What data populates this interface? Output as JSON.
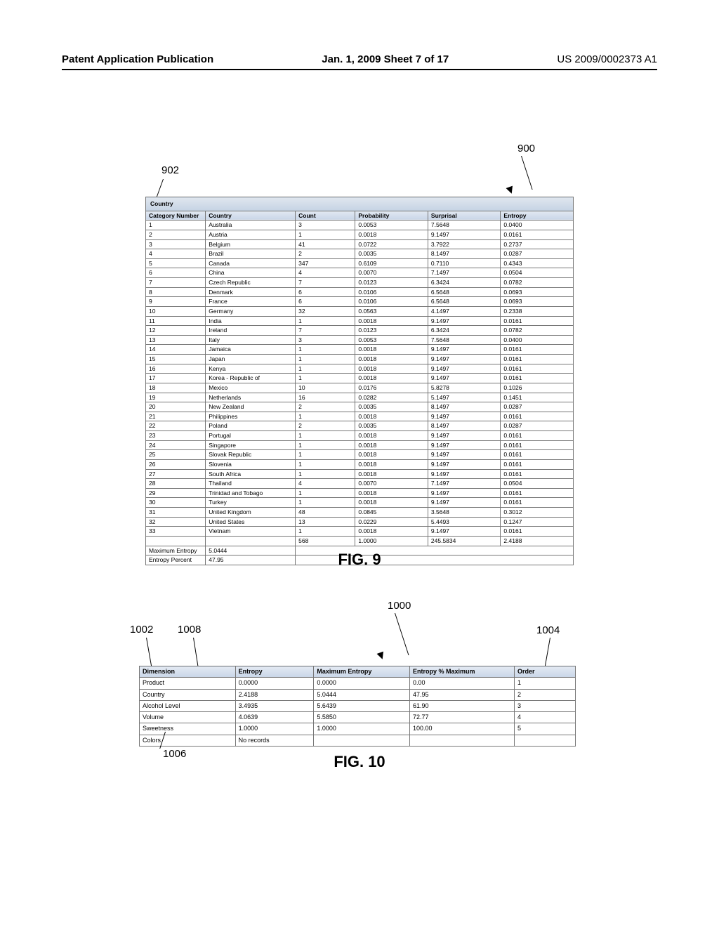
{
  "header": {
    "left": "Patent Application Publication",
    "center": "Jan. 1, 2009  Sheet 7 of 17",
    "right": "US 2009/0002373 A1"
  },
  "callouts": {
    "c900": "900",
    "c902": "902",
    "c1000": "1000",
    "c1002": "1002",
    "c1004": "1004",
    "c1006": "1006",
    "c1008": "1008"
  },
  "fig9": {
    "title": "Country",
    "headers": [
      "Category Number",
      "Country",
      "Count",
      "Probability",
      "Surprisal",
      "Entropy"
    ],
    "rows": [
      [
        "1",
        "Australia",
        "3",
        "0.0053",
        "7.5648",
        "0.0400"
      ],
      [
        "2",
        "Austria",
        "1",
        "0.0018",
        "9.1497",
        "0.0161"
      ],
      [
        "3",
        "Belgium",
        "41",
        "0.0722",
        "3.7922",
        "0.2737"
      ],
      [
        "4",
        "Brazil",
        "2",
        "0.0035",
        "8.1497",
        "0.0287"
      ],
      [
        "5",
        "Canada",
        "347",
        "0.6109",
        "0.7110",
        "0.4343"
      ],
      [
        "6",
        "China",
        "4",
        "0.0070",
        "7.1497",
        "0.0504"
      ],
      [
        "7",
        "Czech Republic",
        "7",
        "0.0123",
        "6.3424",
        "0.0782"
      ],
      [
        "8",
        "Denmark",
        "6",
        "0.0106",
        "6.5648",
        "0.0693"
      ],
      [
        "9",
        "France",
        "6",
        "0.0106",
        "6.5648",
        "0.0693"
      ],
      [
        "10",
        "Germany",
        "32",
        "0.0563",
        "4.1497",
        "0.2338"
      ],
      [
        "11",
        "India",
        "1",
        "0.0018",
        "9.1497",
        "0.0161"
      ],
      [
        "12",
        "Ireland",
        "7",
        "0.0123",
        "6.3424",
        "0.0782"
      ],
      [
        "13",
        "Italy",
        "3",
        "0.0053",
        "7.5648",
        "0.0400"
      ],
      [
        "14",
        "Jamaica",
        "1",
        "0.0018",
        "9.1497",
        "0.0161"
      ],
      [
        "15",
        "Japan",
        "1",
        "0.0018",
        "9.1497",
        "0.0161"
      ],
      [
        "16",
        "Kenya",
        "1",
        "0.0018",
        "9.1497",
        "0.0161"
      ],
      [
        "17",
        "Korea - Republic of",
        "1",
        "0.0018",
        "9.1497",
        "0.0161"
      ],
      [
        "18",
        "Mexico",
        "10",
        "0.0176",
        "5.8278",
        "0.1026"
      ],
      [
        "19",
        "Netherlands",
        "16",
        "0.0282",
        "5.1497",
        "0.1451"
      ],
      [
        "20",
        "New Zealand",
        "2",
        "0.0035",
        "8.1497",
        "0.0287"
      ],
      [
        "21",
        "Philippines",
        "1",
        "0.0018",
        "9.1497",
        "0.0161"
      ],
      [
        "22",
        "Poland",
        "2",
        "0.0035",
        "8.1497",
        "0.0287"
      ],
      [
        "23",
        "Portugal",
        "1",
        "0.0018",
        "9.1497",
        "0.0161"
      ],
      [
        "24",
        "Singapore",
        "1",
        "0.0018",
        "9.1497",
        "0.0161"
      ],
      [
        "25",
        "Slovak Republic",
        "1",
        "0.0018",
        "9.1497",
        "0.0161"
      ],
      [
        "26",
        "Slovenia",
        "1",
        "0.0018",
        "9.1497",
        "0.0161"
      ],
      [
        "27",
        "South Africa",
        "1",
        "0.0018",
        "9.1497",
        "0.0161"
      ],
      [
        "28",
        "Thailand",
        "4",
        "0.0070",
        "7.1497",
        "0.0504"
      ],
      [
        "29",
        "Trinidad and Tobago",
        "1",
        "0.0018",
        "9.1497",
        "0.0161"
      ],
      [
        "30",
        "Turkey",
        "1",
        "0.0018",
        "9.1497",
        "0.0161"
      ],
      [
        "31",
        "United Kingdom",
        "48",
        "0.0845",
        "3.5648",
        "0.3012"
      ],
      [
        "32",
        "United States",
        "13",
        "0.0229",
        "5.4493",
        "0.1247"
      ],
      [
        "33",
        "Vietnam",
        "1",
        "0.0018",
        "9.1497",
        "0.0161"
      ]
    ],
    "total_row": [
      "",
      "",
      "568",
      "1.0000",
      "245.5834",
      "2.4188"
    ],
    "max_entropy_label": "Maximum Entropy",
    "max_entropy_value": "5.0444",
    "entropy_percent_label": "Entropy Percent",
    "entropy_percent_value": "47.95",
    "caption": "FIG. 9"
  },
  "fig10": {
    "headers": [
      "Dimension",
      "Entropy",
      "Maximum Entropy",
      "Entropy % Maximum",
      "Order"
    ],
    "rows": [
      [
        "Product",
        "0.0000",
        "0.0000",
        "0.00",
        "1"
      ],
      [
        "Country",
        "2.4188",
        "5.0444",
        "47.95",
        "2"
      ],
      [
        "Alcohol Level",
        "3.4935",
        "5.6439",
        "61.90",
        "3"
      ],
      [
        "Volume",
        "4.0639",
        "5.5850",
        "72.77",
        "4"
      ],
      [
        "Sweetness",
        "1.0000",
        "1.0000",
        "100.00",
        "5"
      ],
      [
        "Colors",
        "No records",
        "",
        "",
        ""
      ]
    ],
    "caption": "FIG. 10"
  }
}
